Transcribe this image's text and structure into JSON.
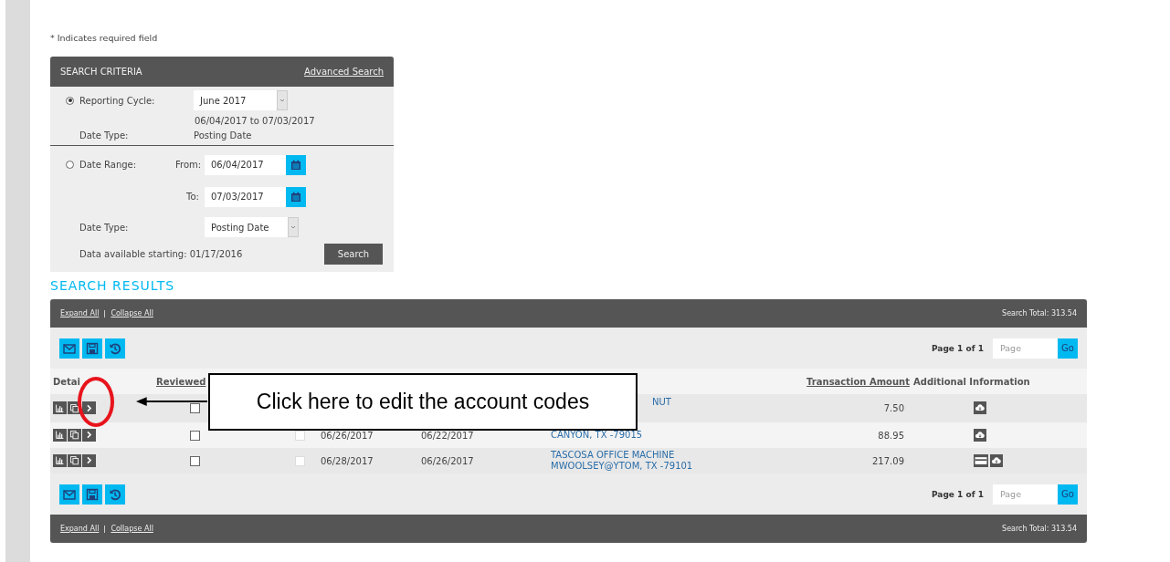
{
  "required_note": "* Indicates required field",
  "search_criteria": {
    "title": "SEARCH CRITERIA",
    "advanced_link": "Advanced Search",
    "reporting_cycle": {
      "label": "Reporting Cycle:",
      "selected": true,
      "value": "June 2017",
      "range": "06/04/2017 to 07/03/2017",
      "date_type_label": "Date Type:",
      "date_type": "Posting Date"
    },
    "date_range": {
      "label": "Date Range:",
      "selected": false,
      "from_label": "From:",
      "from": "06/04/2017",
      "to_label": "To:",
      "to": "07/03/2017",
      "date_type_label": "Date Type:",
      "date_type": "Posting Date"
    },
    "availability": "Data available starting: 01/17/2016",
    "search_button": "Search"
  },
  "results": {
    "title": "SEARCH RESULTS",
    "top_bar": {
      "expand_all": "Expand All",
      "collapse_all": "Collapse All",
      "search_total": "Search Total: 313.54"
    },
    "top_pager": {
      "label": "Page 1 of 1",
      "placeholder": "Page",
      "go": "Go"
    },
    "columns": [
      {
        "label": "Detai",
        "sortable": false
      },
      {
        "label": "Reviewed",
        "sortable": true
      },
      {
        "label": "Transaction Amount",
        "sortable": true
      },
      {
        "label": "Additional Information",
        "sortable": false
      }
    ],
    "rows": [
      {
        "reviewed": false,
        "merchant": [
          "NUT"
        ],
        "amount": "7.50",
        "info": [
          {
            "kind": "cloud"
          }
        ]
      },
      {
        "reviewed": false,
        "flag": {
          "checked": false,
          "disabled": true
        },
        "posted": "06/26/2017",
        "transaction": "06/22/2017",
        "merchant": [
          "CANYON, TX -79015"
        ],
        "amount": "88.95",
        "info": [
          {
            "kind": "cloud"
          }
        ]
      },
      {
        "reviewed": false,
        "flag": {
          "checked": false,
          "disabled": true
        },
        "posted": "06/28/2017",
        "transaction": "06/26/2017",
        "merchant": [
          "TASCOSA OFFICE MACHINE",
          "MWOOLSEY@YTOM, TX -79101"
        ],
        "amount": "217.09",
        "info": [
          {
            "kind": "card"
          },
          {
            "kind": "cloud"
          }
        ]
      }
    ],
    "bottom_pager": {
      "label": "Page 1 of 1",
      "placeholder": "Page",
      "go": "Go"
    },
    "bottom_bar": {
      "expand_all": "Expand All",
      "collapse_all": "Collapse All",
      "search_total": "Search Total: 313.54"
    }
  },
  "callout": {
    "text": "Click here to edit the account codes"
  }
}
